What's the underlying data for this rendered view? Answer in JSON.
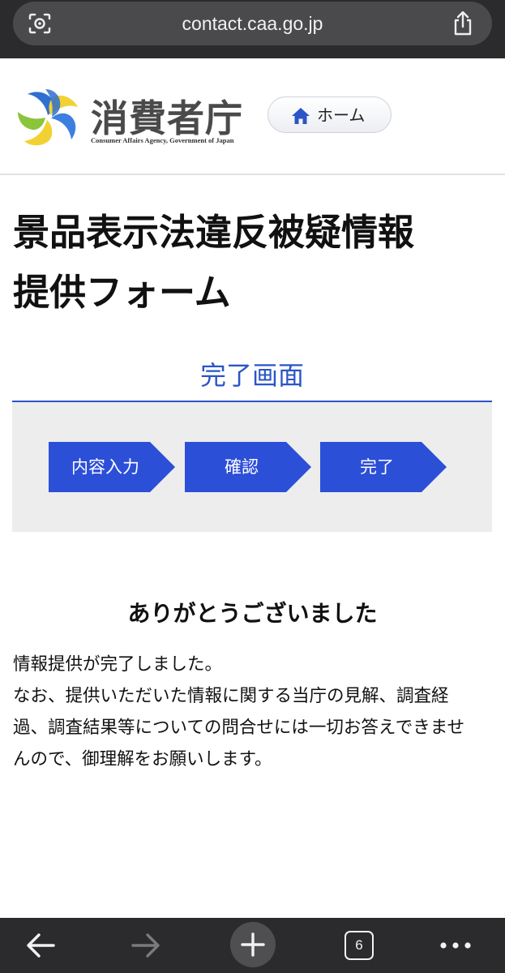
{
  "browser": {
    "url": "contact.caa.go.jp",
    "tab_count": "6"
  },
  "header": {
    "logo_title": "消費者庁",
    "logo_subtitle": "Consumer Affairs Agency, Government of Japan",
    "home_label": "ホーム"
  },
  "page": {
    "title_line1": "景品表示法違反被疑情報",
    "title_line2": "提供フォーム",
    "section_heading": "完了画面"
  },
  "steps": [
    {
      "label": "内容入力"
    },
    {
      "label": "確認"
    },
    {
      "label": "完了"
    }
  ],
  "thanks": {
    "heading": "ありがとうございました",
    "line1": "情報提供が完了しました。",
    "line2": "なお、提供いただいた情報に関する当庁の見解、調査経過、調査結果等についての問合せには一切お答えできませんので、御理解をお願いします。"
  },
  "colors": {
    "accent_blue": "#2b55c7",
    "step_blue": "#2c4fd8",
    "browser_chrome": "#2b2b2d"
  }
}
